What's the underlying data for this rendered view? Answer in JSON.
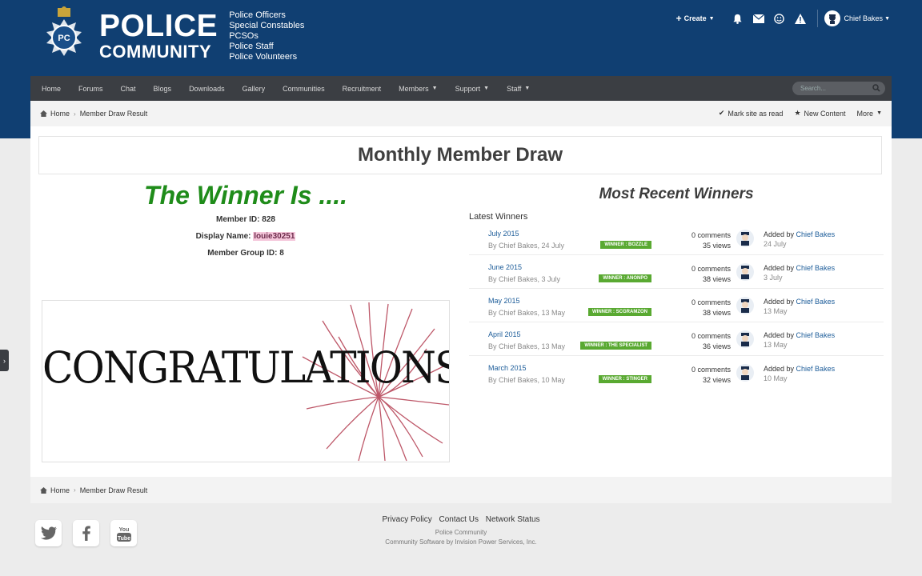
{
  "brand": {
    "line1": "POLICE",
    "line2": "COMMUNITY",
    "badge": "PC",
    "roles": [
      "Police Officers",
      "Special Constables",
      "PCSOs",
      "Police Staff",
      "Police Volunteers"
    ]
  },
  "user_bar": {
    "create": "Create",
    "user": "Chief Bakes",
    "icons": [
      "bell-icon",
      "envelope-icon",
      "smiley-icon",
      "warning-icon"
    ]
  },
  "nav": {
    "items": [
      {
        "label": "Home",
        "dropdown": false
      },
      {
        "label": "Forums",
        "dropdown": false
      },
      {
        "label": "Chat",
        "dropdown": false
      },
      {
        "label": "Blogs",
        "dropdown": false
      },
      {
        "label": "Downloads",
        "dropdown": false
      },
      {
        "label": "Gallery",
        "dropdown": false
      },
      {
        "label": "Communities",
        "dropdown": false
      },
      {
        "label": "Recruitment",
        "dropdown": false
      },
      {
        "label": "Members",
        "dropdown": true
      },
      {
        "label": "Support",
        "dropdown": true
      },
      {
        "label": "Staff",
        "dropdown": true
      }
    ],
    "search_placeholder": "Search..."
  },
  "breadcrumb": {
    "home": "Home",
    "current": "Member Draw Result"
  },
  "actions": {
    "mark_read": "Mark site as read",
    "new_content": "New Content",
    "more": "More"
  },
  "page": {
    "title": "Monthly Member Draw",
    "winner_title": "The Winner Is ....",
    "member_id_label": "Member ID:",
    "member_id": "828",
    "display_name_label": "Display Name:",
    "display_name": "louie30251",
    "group_label": "Member Group ID:",
    "group_id": "8",
    "congrats": "CONGRATULATIONS"
  },
  "recent": {
    "title": "Most Recent Winners",
    "latest_label": "Latest Winners",
    "rows": [
      {
        "month": "July 2015",
        "by": "By Chief Bakes, 24 July",
        "tag": "WINNER : BOZZLE",
        "comments": "0 comments",
        "views": "35 views",
        "added_by": "Added by",
        "name": "Chief Bakes",
        "date": "24 July"
      },
      {
        "month": "June 2015",
        "by": "By Chief Bakes, 3 July",
        "tag": "WINNER : ANONPO",
        "comments": "0 comments",
        "views": "38 views",
        "added_by": "Added by",
        "name": "Chief Bakes",
        "date": "3 July"
      },
      {
        "month": "May 2015",
        "by": "By Chief Bakes, 13 May",
        "tag": "WINNER : SCGRAMZON",
        "comments": "0 comments",
        "views": "38 views",
        "added_by": "Added by",
        "name": "Chief Bakes",
        "date": "13 May"
      },
      {
        "month": "April 2015",
        "by": "By Chief Bakes, 13 May",
        "tag": "WINNER : THE SPECIALIST",
        "comments": "0 comments",
        "views": "36 views",
        "added_by": "Added by",
        "name": "Chief Bakes",
        "date": "13 May"
      },
      {
        "month": "March 2015",
        "by": "By Chief Bakes, 10 May",
        "tag": "WINNER : STINGER",
        "comments": "0 comments",
        "views": "32 views",
        "added_by": "Added by",
        "name": "Chief Bakes",
        "date": "10 May"
      }
    ]
  },
  "footer": {
    "links": [
      "Privacy Policy",
      "Contact Us",
      "Network Status"
    ],
    "site": "Police Community",
    "software": "Community Software by Invision Power Services, Inc.",
    "social": [
      "twitter-icon",
      "facebook-icon",
      "youtube-icon"
    ]
  },
  "colors": {
    "header": "#103f72",
    "nav": "#3b3e43",
    "winner_green": "#1f8c1a",
    "tag_green": "#59a931",
    "link": "#1c5c99"
  }
}
